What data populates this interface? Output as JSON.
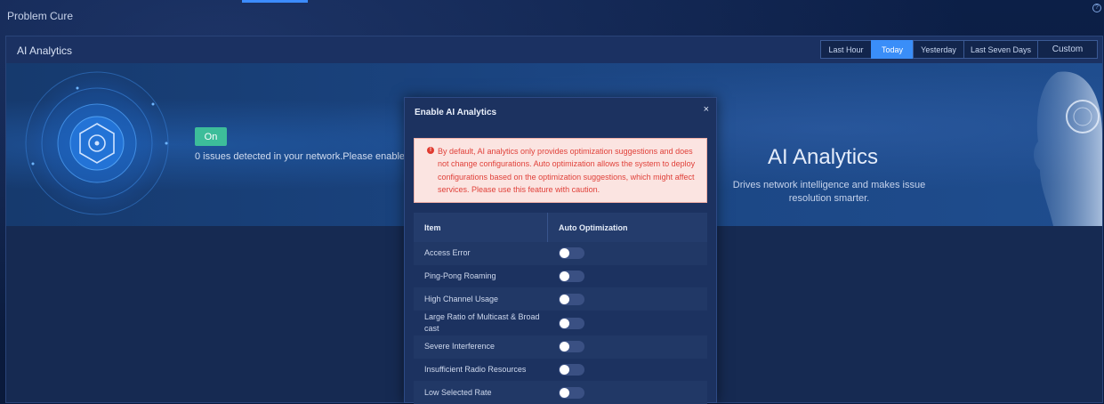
{
  "app": {
    "title": "Problem Cure",
    "help_icon": "?"
  },
  "panel": {
    "title": "AI Analytics"
  },
  "time_range": {
    "options": [
      "Last Hour",
      "Today",
      "Yesterday",
      "Last Seven Days",
      "Custom"
    ],
    "selected": "Today"
  },
  "banner": {
    "toggle_label": "On",
    "issues_text": "0 issues detected in your network.Please enable.",
    "hero_title": "AI Analytics",
    "hero_subtitle": "Drives network intelligence and makes issue resolution smarter."
  },
  "modal": {
    "title": "Enable AI Analytics",
    "close": "×",
    "warning_icon": "!",
    "warning": "By default, AI analytics only provides optimization suggestions and does not change configurations. Auto optimization allows the system to deploy configurations based on the optimization suggestions, which might affect services. Please use this feature with caution.",
    "columns": {
      "item": "Item",
      "auto": "Auto Optimization"
    },
    "rows": [
      {
        "label": "Access Error",
        "enabled": false
      },
      {
        "label": "Ping-Pong Roaming",
        "enabled": false
      },
      {
        "label": "High Channel Usage",
        "enabled": false
      },
      {
        "label": "Large Ratio of Multicast & Broadcast",
        "enabled": false
      },
      {
        "label": "Severe Interference",
        "enabled": false
      },
      {
        "label": "Insufficient Radio Resources",
        "enabled": false
      },
      {
        "label": "Low Selected Rate",
        "enabled": false
      }
    ]
  },
  "colors": {
    "accent": "#3a8ef8",
    "on_button": "#3dbd9a",
    "warning_text": "#e0413a",
    "warning_bg": "#fbe4e1"
  }
}
